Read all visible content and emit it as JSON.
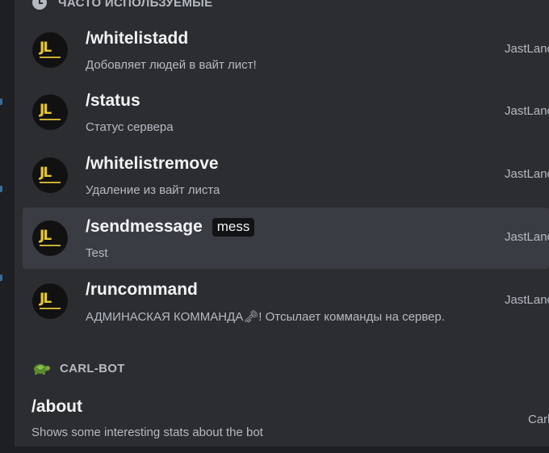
{
  "frequent_header": "ЧАСТО ИСПОЛЬЗУЕМЫЕ",
  "commands": [
    {
      "name": "/whitelistadd",
      "option": "",
      "description": "Добовляет людей в вайт лист!",
      "app": "JastLanc"
    },
    {
      "name": "/status",
      "option": "",
      "description": "Статус сервера",
      "app": "JastLanc"
    },
    {
      "name": "/whitelistremove",
      "option": "",
      "description": "Удаление из вайт листа",
      "app": "JastLanc"
    },
    {
      "name": "/sendmessage",
      "option": "mess",
      "description": "Test",
      "app": "JastLanc"
    },
    {
      "name": "/runcommand",
      "option": "",
      "description": "АДМИНАСКАЯ КОММАНДА🗝! Отсылает комманды на сервер.",
      "app": "JastLanc"
    }
  ],
  "avatar_logo": "JL",
  "carlbot": {
    "header": "CARL-BOT",
    "command": "/about",
    "description": "Shows some interesting stats about the bot",
    "app": "Carl"
  },
  "colors": {
    "background": "#2b2d31",
    "active_row": "#3a3c43",
    "logo_yellow": "#e7c830"
  }
}
